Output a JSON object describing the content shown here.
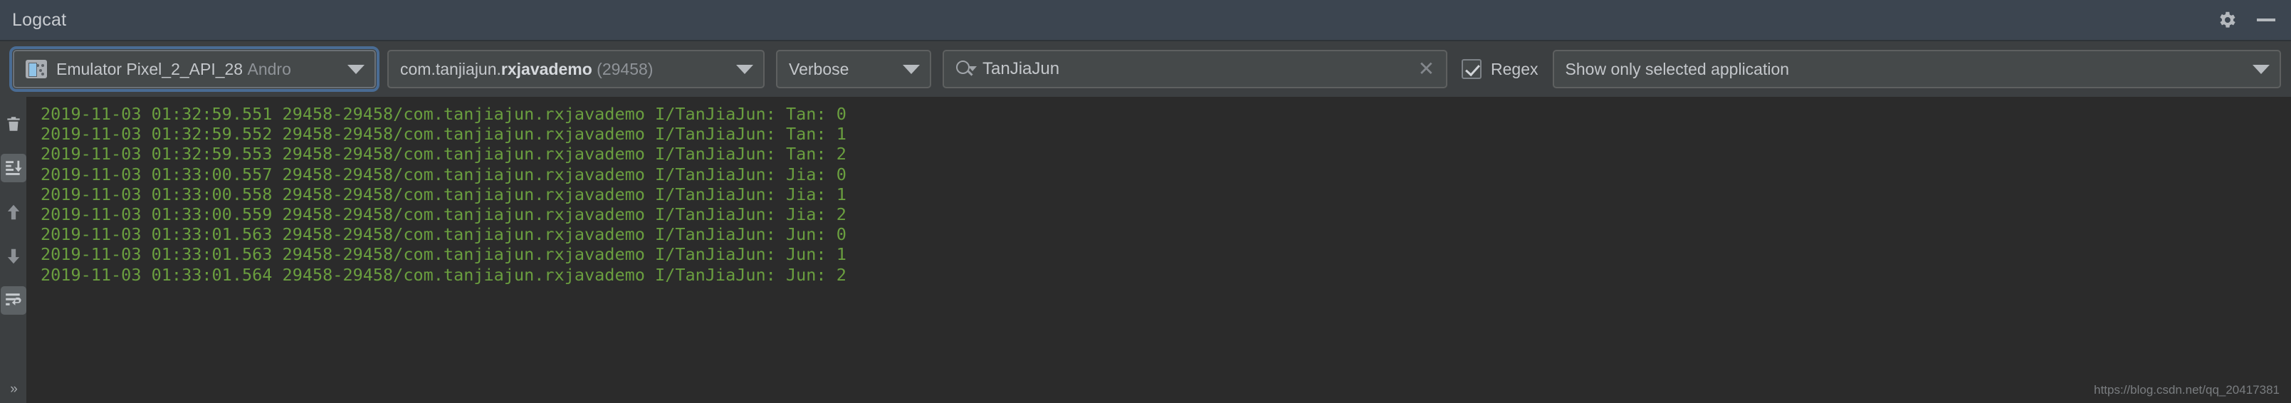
{
  "window": {
    "title": "Logcat",
    "settings_icon": "gear-icon",
    "minimize_icon": "minimize-icon"
  },
  "toolbar": {
    "device": {
      "icon": "device-icon",
      "name": "Emulator Pixel_2_API_28",
      "suffix": "Andro",
      "caret": "chevron-down-icon"
    },
    "process": {
      "prefix": "com.tanjiajun.",
      "bold": "rxjavademo",
      "pid": "(29458)",
      "caret": "chevron-down-icon"
    },
    "log_level": {
      "value": "Verbose",
      "caret": "chevron-down-icon"
    },
    "search": {
      "icon": "search-icon",
      "value": "TanJiaJun",
      "placeholder": "",
      "clear_icon": "close-icon"
    },
    "regex": {
      "label": "Regex",
      "checked": true
    },
    "filter": {
      "value": "Show only selected application",
      "caret": "chevron-down-icon"
    }
  },
  "rail": {
    "items": [
      {
        "name": "clear-logcat-button",
        "icon": "trash-icon",
        "active": false
      },
      {
        "name": "scroll-to-end-button",
        "icon": "scroll-to-end-icon",
        "active": true
      },
      {
        "name": "up-the-stack-trace-button",
        "icon": "arrow-up-icon",
        "active": false
      },
      {
        "name": "down-the-stack-trace-button",
        "icon": "arrow-down-icon",
        "active": false
      },
      {
        "name": "soft-wrap-button",
        "icon": "soft-wrap-icon",
        "active": true
      }
    ],
    "expand": "»"
  },
  "log": {
    "text_color": "#6a9e3f",
    "background": "#2b2b2b",
    "lines": [
      "2019-11-03 01:32:59.551 29458-29458/com.tanjiajun.rxjavademo I/TanJiaJun: Tan: 0",
      "2019-11-03 01:32:59.552 29458-29458/com.tanjiajun.rxjavademo I/TanJiaJun: Tan: 1",
      "2019-11-03 01:32:59.553 29458-29458/com.tanjiajun.rxjavademo I/TanJiaJun: Tan: 2",
      "2019-11-03 01:33:00.557 29458-29458/com.tanjiajun.rxjavademo I/TanJiaJun: Jia: 0",
      "2019-11-03 01:33:00.558 29458-29458/com.tanjiajun.rxjavademo I/TanJiaJun: Jia: 1",
      "2019-11-03 01:33:00.559 29458-29458/com.tanjiajun.rxjavademo I/TanJiaJun: Jia: 2",
      "2019-11-03 01:33:01.563 29458-29458/com.tanjiajun.rxjavademo I/TanJiaJun: Jun: 0",
      "2019-11-03 01:33:01.563 29458-29458/com.tanjiajun.rxjavademo I/TanJiaJun: Jun: 1",
      "2019-11-03 01:33:01.564 29458-29458/com.tanjiajun.rxjavademo I/TanJiaJun: Jun: 2"
    ]
  },
  "watermark": "https://blog.csdn.net/qq_20417381"
}
